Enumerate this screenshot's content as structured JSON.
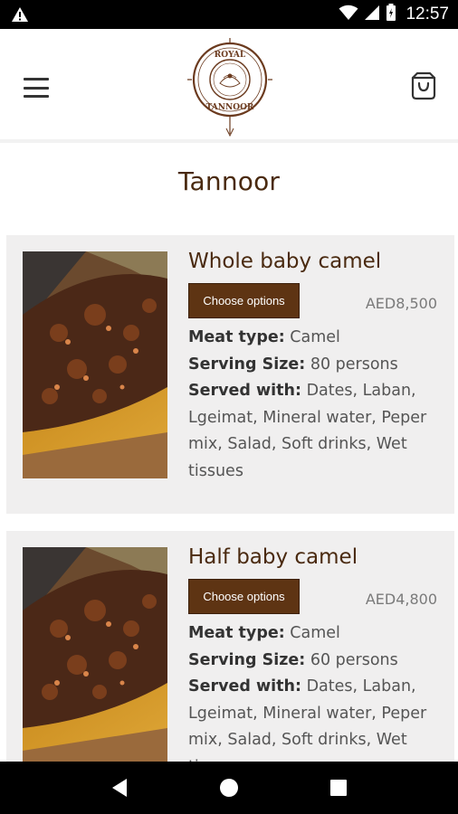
{
  "status_bar": {
    "time": "12:57",
    "icons": [
      "warning-icon",
      "wifi-icon",
      "signal-icon",
      "battery-icon"
    ]
  },
  "header": {
    "logo_text_top": "ROYAL",
    "logo_text_bottom": "TANNOOR",
    "icons": [
      "hamburger-menu-icon",
      "shopping-bag-icon"
    ]
  },
  "page": {
    "title": "Tannoor"
  },
  "products": [
    {
      "name": "Whole baby camel",
      "button_label": "Choose options",
      "price": "AED8,500",
      "meat_type_label": "Meat type:",
      "meat_type": "Camel",
      "serving_size_label": "Serving Size:",
      "serving_size": "80 persons",
      "served_with_label": "Served with:",
      "served_with": "Dates, Laban, Lgeimat, Mineral water, Peper mix, Salad, Soft drinks, Wet tissues"
    },
    {
      "name": "Half baby camel",
      "button_label": "Choose options",
      "price": "AED4,800",
      "meat_type_label": "Meat type:",
      "meat_type": "Camel",
      "serving_size_label": "Serving Size:",
      "serving_size": "60 persons",
      "served_with_label": "Served with:",
      "served_with": "Dates, Laban, Lgeimat, Mineral water, Peper mix, Salad, Soft drinks, Wet tissues"
    }
  ],
  "nav_bar": {
    "icons": [
      "back-icon",
      "home-icon",
      "recents-icon"
    ]
  },
  "colors": {
    "brand_brown": "#5e3413",
    "title_brown": "#4a2a10",
    "card_background": "#f0efef"
  }
}
